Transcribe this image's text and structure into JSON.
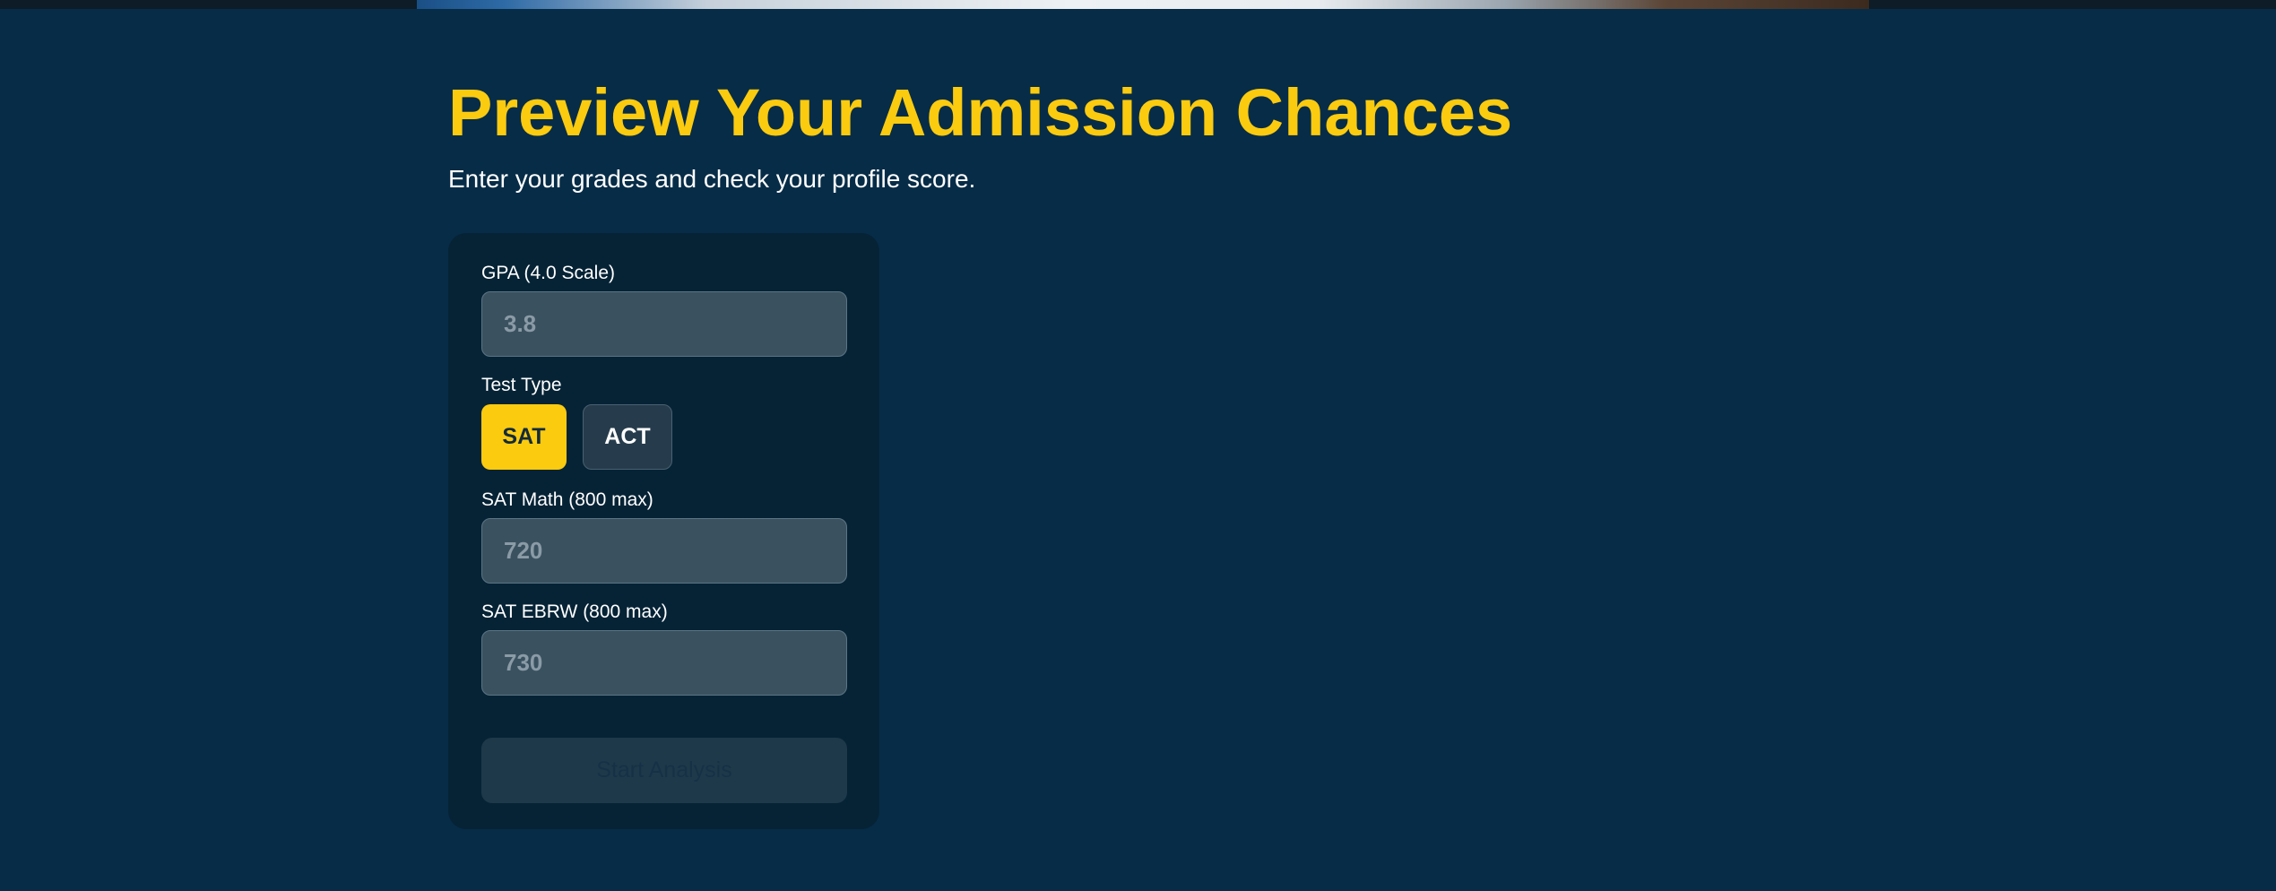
{
  "hero": {
    "title": "Preview Your Admission Chances",
    "subtitle": "Enter your grades and check your profile score."
  },
  "form": {
    "gpa": {
      "label": "GPA (4.0 Scale)",
      "placeholder": "3.8"
    },
    "test_type": {
      "label": "Test Type",
      "options": [
        "SAT",
        "ACT"
      ],
      "selected": "SAT"
    },
    "sat_math": {
      "label": "SAT Math (800 max)",
      "placeholder": "720"
    },
    "sat_ebrw": {
      "label": "SAT EBRW (800 max)",
      "placeholder": "730"
    },
    "submit_label": "Start Analysis"
  },
  "colors": {
    "background": "#072c47",
    "card": "#062336",
    "accent": "#fbcb10"
  }
}
